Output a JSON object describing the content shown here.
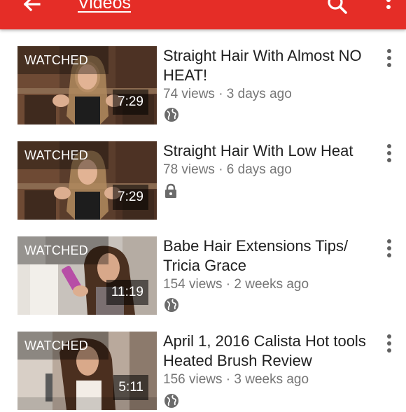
{
  "appbar": {
    "title": "Videos",
    "back_icon": "arrow-back-icon",
    "search_icon": "search-icon",
    "overflow_icon": "more-vert-icon",
    "color": "#e52d27"
  },
  "videos": [
    {
      "watched_label": "WATCHED",
      "duration": "7:29",
      "title": "Straight Hair With Almost NO HEAT!",
      "meta": "74 views · 3 days ago",
      "privacy_icon": "public-globe-icon"
    },
    {
      "watched_label": "WATCHED",
      "duration": "7:29",
      "title": "Straight Hair With Low Heat",
      "meta": "78 views · 6 days ago",
      "privacy_icon": "private-lock-icon"
    },
    {
      "watched_label": "WATCHED",
      "duration": "11:19",
      "title": "Babe Hair Extensions Tips/ Tricia Grace",
      "meta": "154 views · 2 weeks ago",
      "privacy_icon": "public-globe-icon"
    },
    {
      "watched_label": "WATCHED",
      "duration": "5:11",
      "title": "April 1, 2016 Calista Hot tools Heated Brush Review",
      "meta": "156 views · 3 weeks ago",
      "privacy_icon": "public-globe-icon"
    }
  ]
}
